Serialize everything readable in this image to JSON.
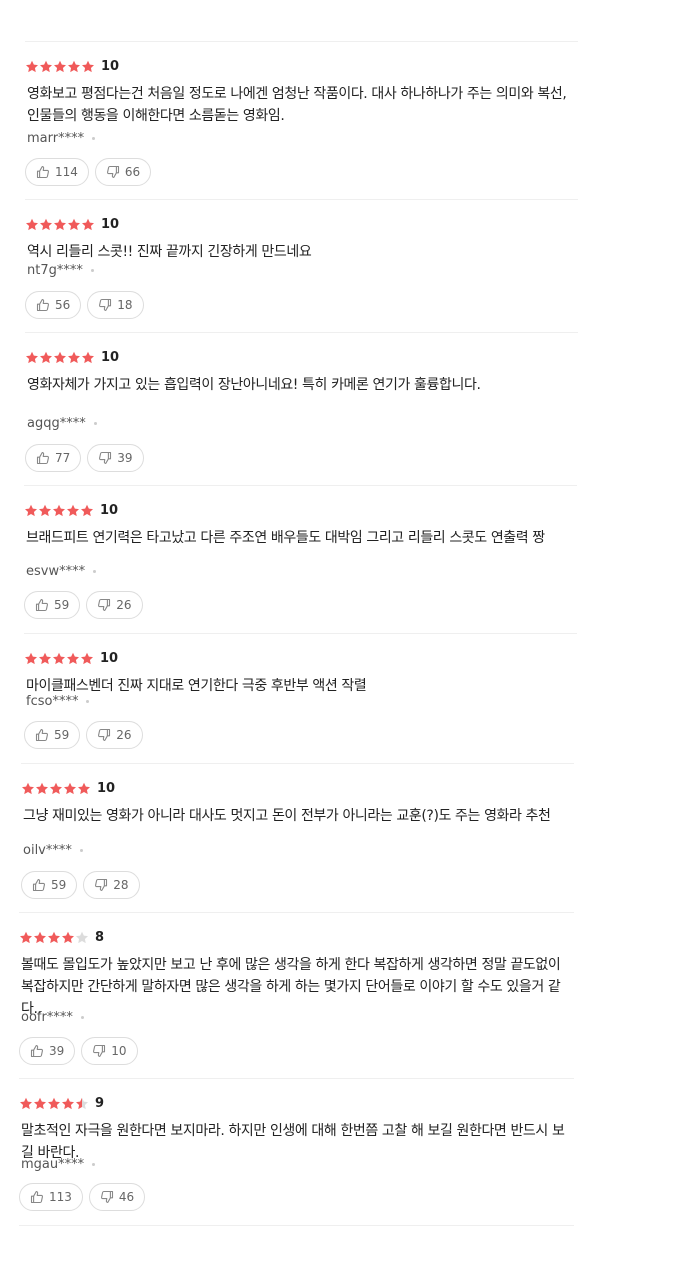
{
  "colors": {
    "star_filled": "#f05a5a",
    "star_empty": "#dcdcdc",
    "border": "#efefef"
  },
  "icons": {
    "like": "thumbs-up-icon",
    "dislike": "thumbs-down-icon",
    "rating": "star-icon"
  },
  "reviews": [
    {
      "rating_stars": 5,
      "score": "10",
      "comment": "영화보고 평점다는건 처음일 정도로 나에겐 엄청난 작품이다. 대사 하나하나가 주는 의미와 복선, 인물들의 행동을 이해한다면 소름돋는 영화임.",
      "author": "marr****",
      "likes": "114",
      "dislikes": "66"
    },
    {
      "rating_stars": 5,
      "score": "10",
      "comment": "역시 리들리 스콧!! 진짜 끝까지 긴장하게 만드네요",
      "author": "nt7g****",
      "likes": "56",
      "dislikes": "18"
    },
    {
      "rating_stars": 5,
      "score": "10",
      "comment": "영화자체가 가지고 있는 흡입력이 장난아니네요! 특히 카메론 연기가 훌륭합니다.",
      "author": "agqg****",
      "likes": "77",
      "dislikes": "39"
    },
    {
      "rating_stars": 5,
      "score": "10",
      "comment": "브래드피트 연기력은 타고났고 다른 주조연 배우들도 대박임 그리고 리들리 스콧도 연출력 짱",
      "author": "esvw****",
      "likes": "59",
      "dislikes": "26"
    },
    {
      "rating_stars": 5,
      "score": "10",
      "comment": "마이클패스벤더 진짜 지대로 연기한다 극중 후반부 액션 작렬",
      "author": "fcso****",
      "likes": "59",
      "dislikes": "26"
    },
    {
      "rating_stars": 5,
      "score": "10",
      "comment": "그냥 재미있는 영화가 아니라 대사도 멋지고 돈이 전부가 아니라는 교훈(?)도 주는 영화라  추천",
      "author": "oilv****",
      "likes": "59",
      "dislikes": "28"
    },
    {
      "rating_stars": 4,
      "score": "8",
      "comment": "볼때도 몰입도가 높았지만 보고 난 후에 많은 생각을 하게 한다 복잡하게 생각하면 정말 끝도없이 복잡하지만 간단하게 말하자면 많은 생각을 하게 하는 몇가지 단어들로 이야기 할 수도 있을거 같다..",
      "author": "oofr****",
      "likes": "39",
      "dislikes": "10"
    },
    {
      "rating_stars": 4.5,
      "score": "9",
      "comment": "말초적인 자극을 원한다면 보지마라. 하지만 인생에 대해 한번쯤 고찰 해 보길 원한다면 반드시 보길 바란다.",
      "author": "mgau****",
      "likes": "113",
      "dislikes": "46"
    }
  ]
}
